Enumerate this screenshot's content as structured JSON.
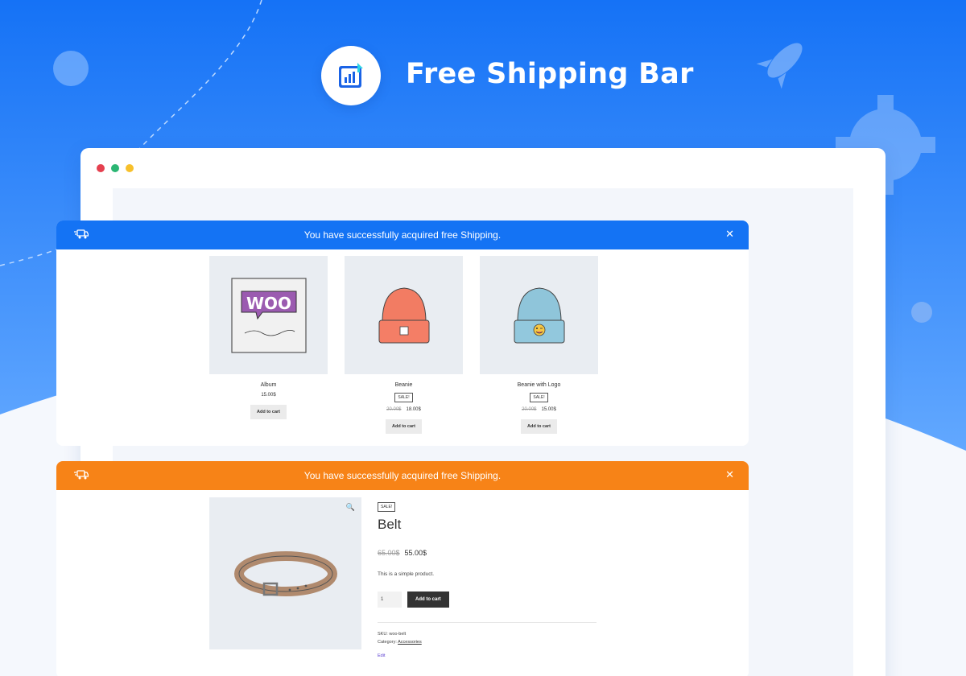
{
  "hero": {
    "title": "Free Shipping Bar",
    "logo": "chart-up-icon",
    "bg_colors": [
      "#1673f5",
      "#5ea6ff"
    ]
  },
  "browser": {
    "controls": [
      "close-dot",
      "minimize-dot",
      "maximize-dot"
    ]
  },
  "shipbar_blue": {
    "message": "You have successfully acquired free Shipping.",
    "color": "#1473f4"
  },
  "shipbar_orange": {
    "message": "You have successfully acquired free Shipping.",
    "color": "#f78317"
  },
  "products": [
    {
      "name": "Album",
      "sale": "",
      "old_price": "",
      "price": "15.00$",
      "button": "Add to cart",
      "image": "woo-album-icon"
    },
    {
      "name": "Beanie",
      "sale": "SALE!",
      "old_price": "20.00$",
      "price": "18.00$",
      "button": "Add to cart",
      "image": "orange-beanie-icon"
    },
    {
      "name": "Beanie with Logo",
      "sale": "SALE!",
      "old_price": "20.00$",
      "price": "15.00$",
      "button": "Add to cart",
      "image": "blue-beanie-icon"
    }
  ],
  "single": {
    "sale": "SALE!",
    "title": "Belt",
    "old_price": "65.00$",
    "price": "55.00$",
    "description": "This is a simple product.",
    "qty": "1",
    "button": "Add to cart",
    "sku_label": "SKU:",
    "sku": "woo-belt",
    "category_label": "Category:",
    "category": "Accessories",
    "edit": "Edit"
  }
}
